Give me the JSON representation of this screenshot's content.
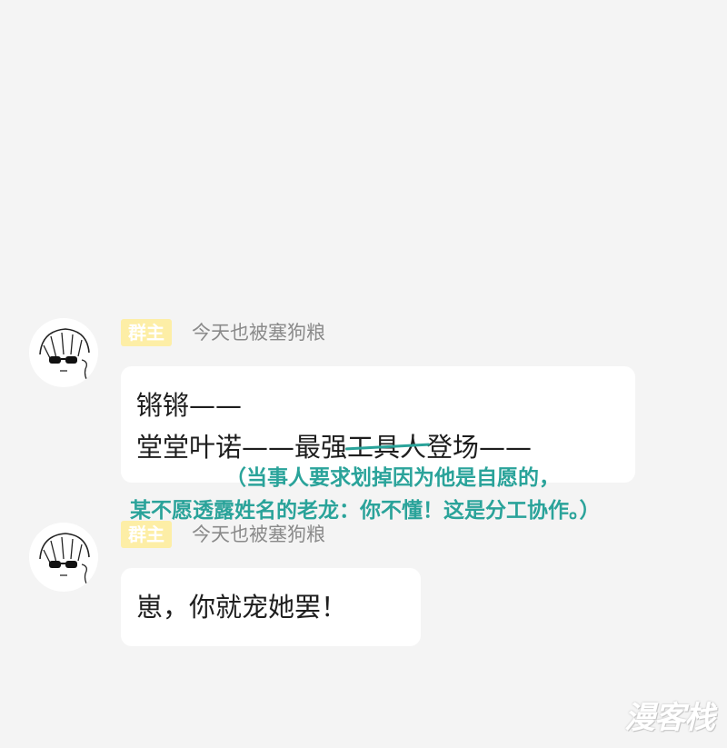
{
  "messages": [
    {
      "badge": "群主",
      "sender": "今天也被塞狗粮",
      "lines": [
        "锵锵——",
        "堂堂叶诺——最强",
        "工具人",
        "登场——"
      ]
    },
    {
      "badge": "群主",
      "sender": "今天也被塞狗粮",
      "text": "崽，你就宠她罢！"
    }
  ],
  "annotation": {
    "line1": "（当事人要求划掉因为他是自愿的，",
    "line2": "某不愿透露姓名的老龙：你不懂！这是分工协作。）"
  },
  "watermark": "漫客栈",
  "colors": {
    "background": "#f4f4f4",
    "bubble": "#ffffff",
    "badge": "#fdeea6",
    "annotation": "#2aa39a"
  },
  "icons": [
    "avatar-sunglasses-icon",
    "watermark-logo"
  ]
}
